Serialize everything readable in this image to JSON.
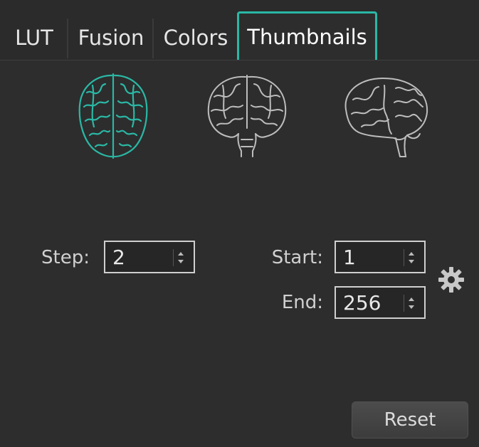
{
  "tabs": [
    {
      "label": "LUT"
    },
    {
      "label": "Fusion"
    },
    {
      "label": "Colors"
    },
    {
      "label": "Thumbnails",
      "active": true
    }
  ],
  "views": [
    "axial",
    "coronal",
    "sagittal"
  ],
  "selected_view": "axial",
  "step": {
    "label": "Step:",
    "value": "2"
  },
  "start": {
    "label": "Start:",
    "value": "1"
  },
  "end": {
    "label": "End:",
    "value": "256"
  },
  "icons": {
    "settings": "gear-icon",
    "spin": "spinner-arrows-icon"
  },
  "reset_label": "Reset",
  "colors": {
    "accent": "#2ab8a5",
    "inactive_brain": "#bdbdbd",
    "background": "#2d2d2d"
  }
}
